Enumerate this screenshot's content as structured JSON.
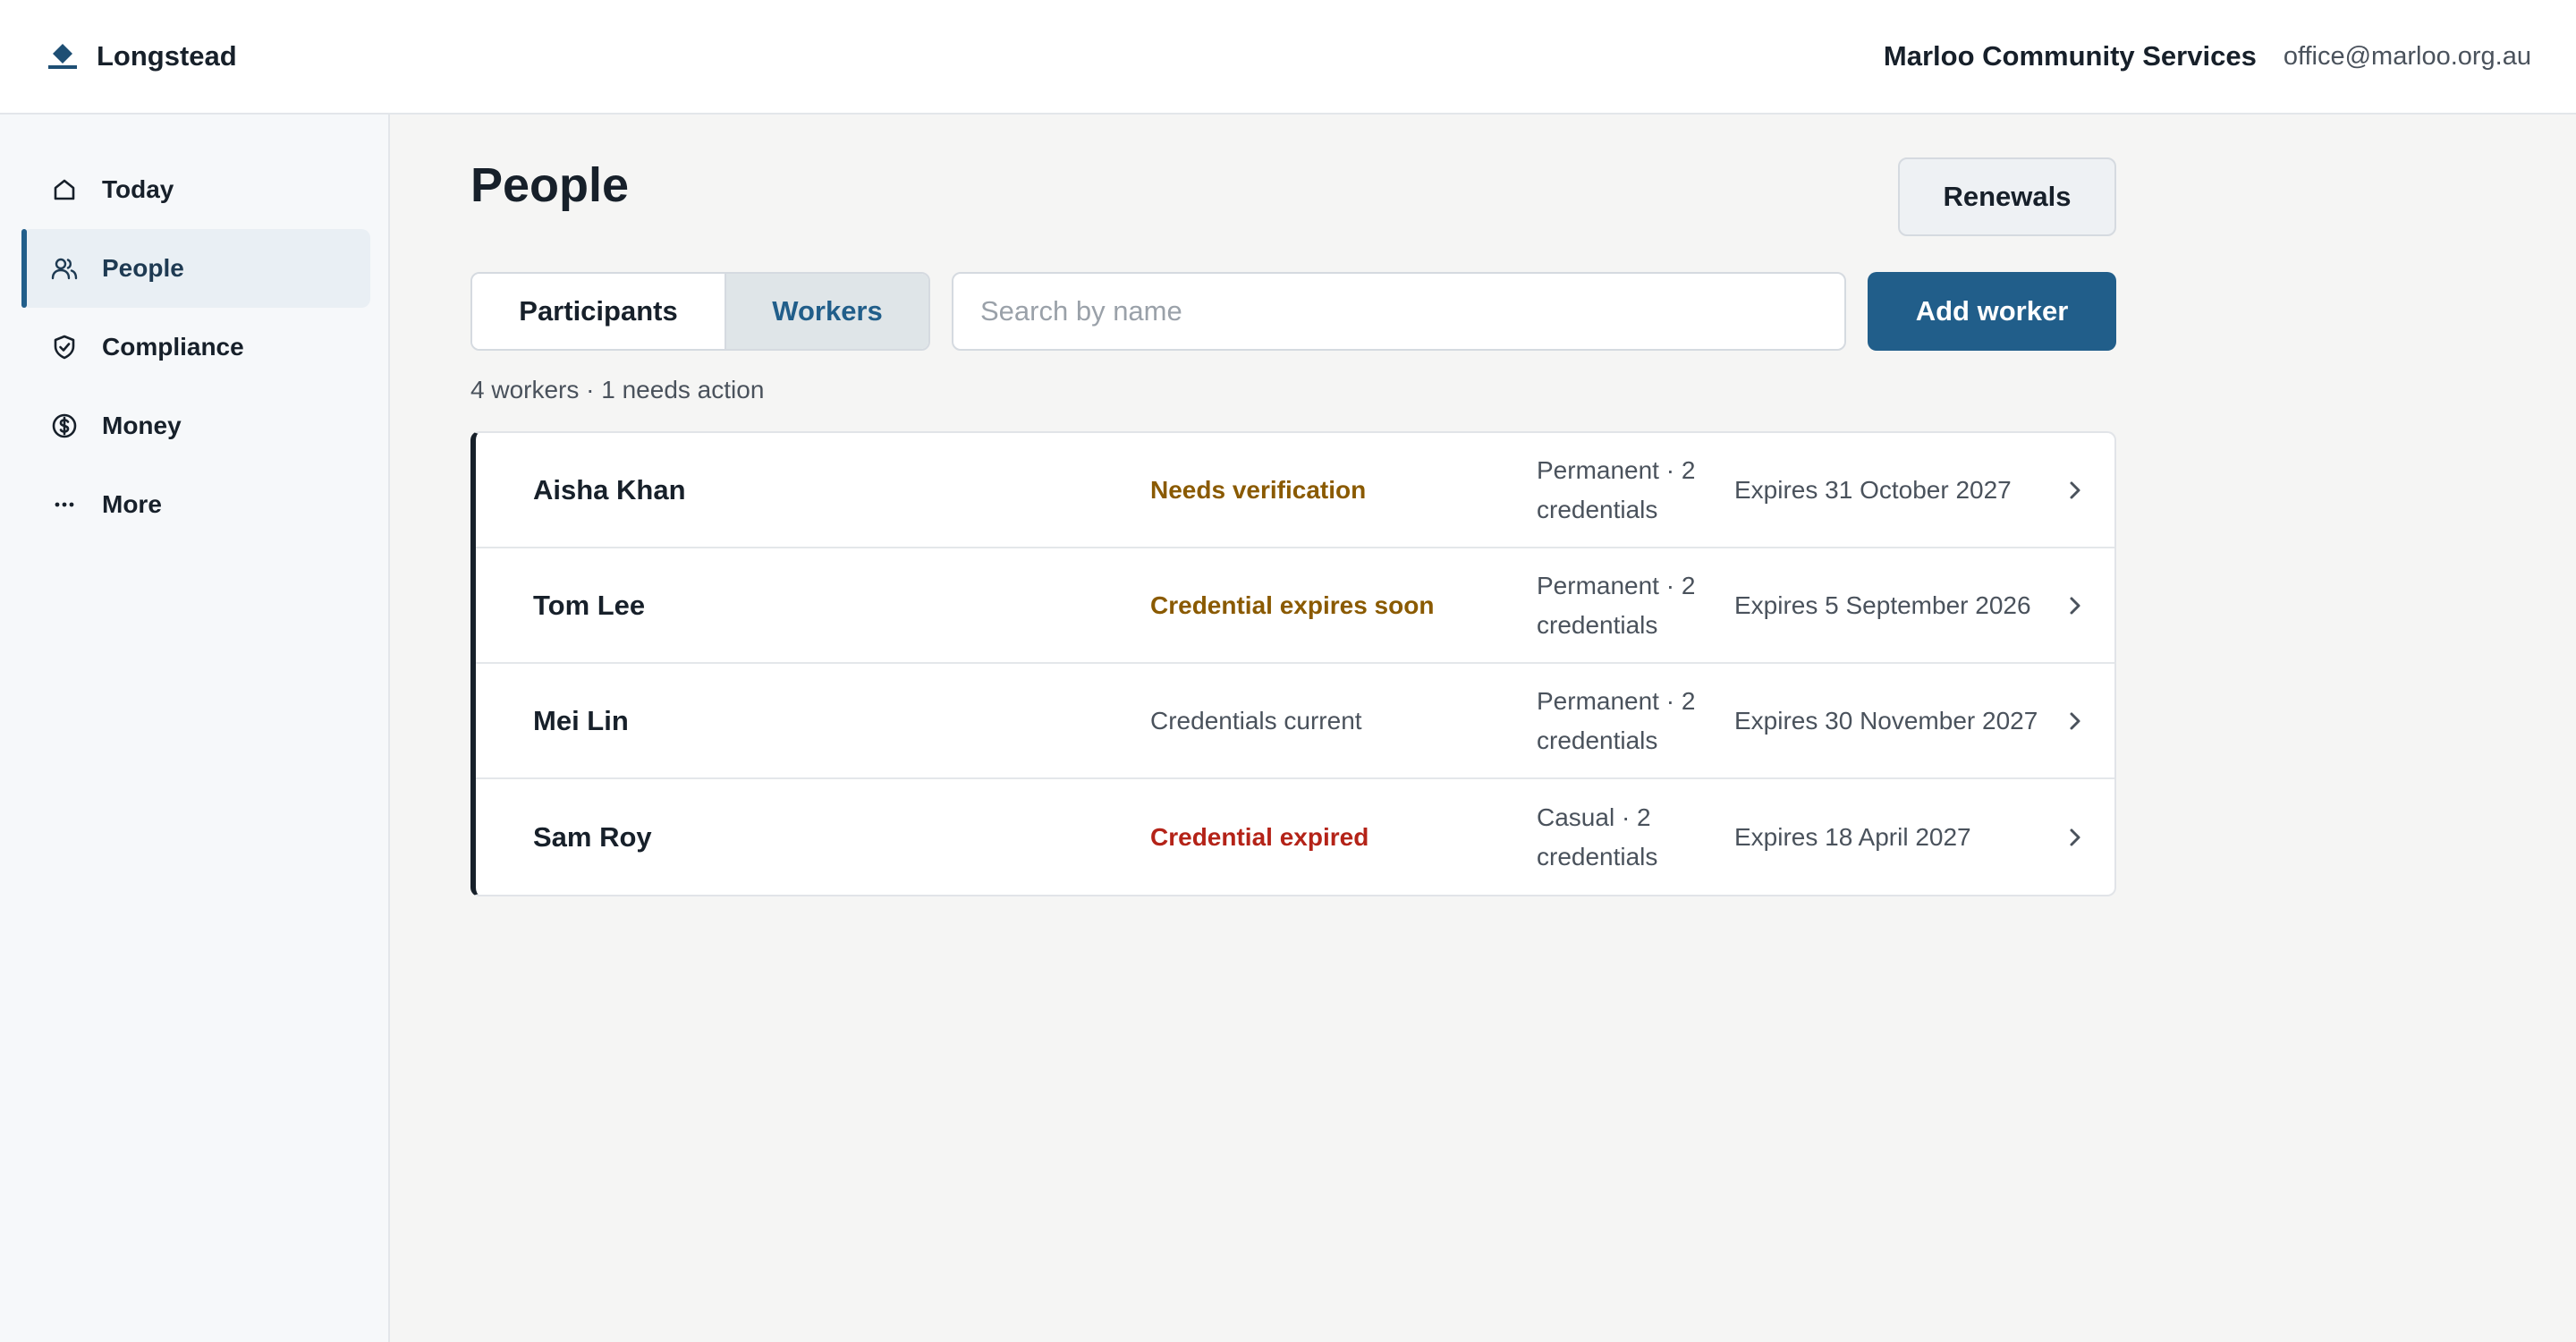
{
  "app": {
    "brand": "Longstead",
    "org_name": "Marloo Community Services",
    "org_email": "office@marloo.org.au"
  },
  "sidebar": {
    "items": [
      {
        "label": "Today",
        "icon": "home-icon"
      },
      {
        "label": "People",
        "icon": "people-icon",
        "active": true
      },
      {
        "label": "Compliance",
        "icon": "shield-check-icon"
      },
      {
        "label": "Money",
        "icon": "dollar-circle-icon"
      },
      {
        "label": "More",
        "icon": "more-dots-icon"
      }
    ]
  },
  "main": {
    "title": "People",
    "renewals_label": "Renewals",
    "tabs": [
      {
        "label": "Participants",
        "selected": false
      },
      {
        "label": "Workers",
        "selected": true
      }
    ],
    "search": {
      "placeholder": "Search by name",
      "value": ""
    },
    "add_label": "Add worker",
    "summary": "4 workers · 1 needs action",
    "workers": [
      {
        "name": "Aisha Khan",
        "status": "Needs verification",
        "tone": "warn",
        "type": "Permanent · 2 credentials",
        "expiry": "Expires 31 October 2027"
      },
      {
        "name": "Tom Lee",
        "status": "Credential expires soon",
        "tone": "warn",
        "type": "Permanent · 2 credentials",
        "expiry": "Expires 5 September 2026"
      },
      {
        "name": "Mei Lin",
        "status": "Credentials current",
        "tone": "ok",
        "type": "Permanent · 2 credentials",
        "expiry": "Expires 30 November 2027"
      },
      {
        "name": "Sam Roy",
        "status": "Credential expired",
        "tone": "bad",
        "type": "Casual · 2 credentials",
        "expiry": "Expires 18 April 2027"
      }
    ]
  },
  "colors": {
    "accent": "#215e8a",
    "warning": "#8a5a00",
    "danger": "#b42318",
    "text": "#17202a",
    "muted": "#4a525c"
  }
}
